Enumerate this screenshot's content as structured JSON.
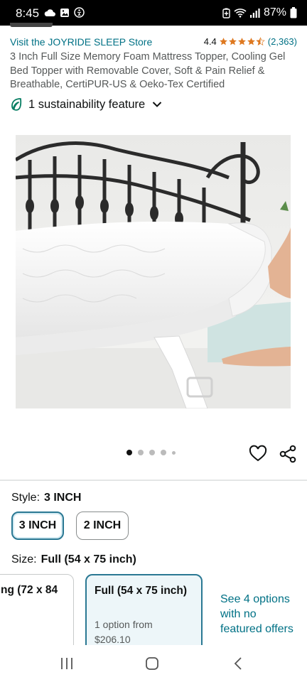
{
  "status_bar": {
    "time": "8:45",
    "battery": "87%"
  },
  "store": {
    "link": "Visit the JOYRIDE SLEEP Store",
    "rating": "4.4",
    "rating_stars": 4.4,
    "review_count": "(2,363)"
  },
  "product": {
    "title": "3 Inch Full Size Memory Foam Mattress Topper, Cooling Gel Bed Topper with Removable Cover, Soft & Pain Relief & Breathable, CertiPUR-US & Oeko-Tex Certified",
    "sustainability": "1 sustainability feature",
    "carousel": {
      "total": 5,
      "active": 1
    }
  },
  "style": {
    "label": "Style:",
    "selected": "3 INCH",
    "options": [
      "3 INCH",
      "2 INCH"
    ]
  },
  "size": {
    "label": "Size:",
    "selected": "Full (54 x 75 inch)",
    "cards": [
      {
        "title": "ng (72 x 84"
      },
      {
        "title": "Full (54 x 75 inch)",
        "line1": "1 option from",
        "line2": "$206.10"
      }
    ],
    "see_more": "See 4 options with no featured offers"
  },
  "colors": {
    "link": "#007185",
    "star": "#de7921",
    "selected_border": "#2a7893",
    "leaf": "#067d62"
  }
}
